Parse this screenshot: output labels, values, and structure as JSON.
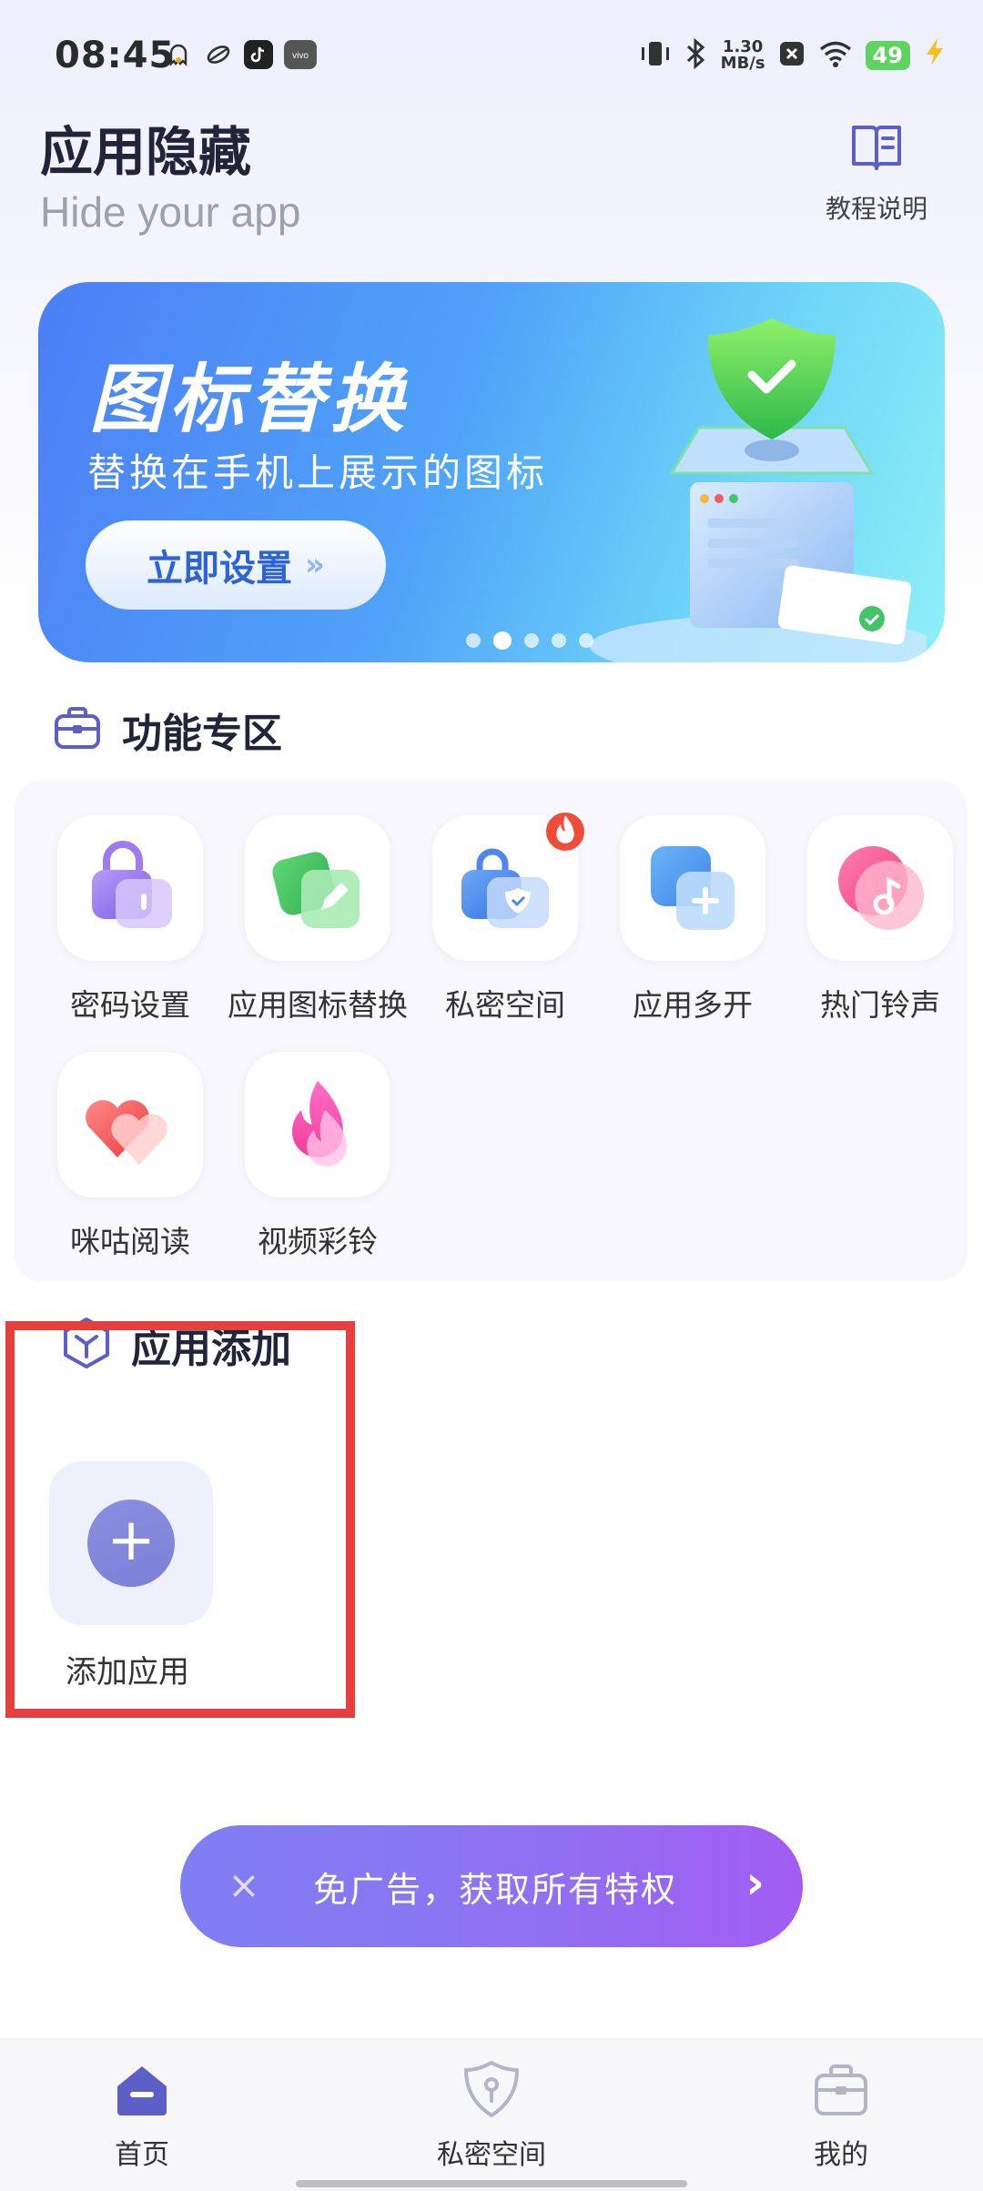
{
  "status_bar": {
    "time": "08:45",
    "speed_value": "1.30",
    "speed_unit": "MB/s",
    "battery": "49",
    "notif_icons": [
      "ghost-icon",
      "leaf-icon",
      "tiktok-icon",
      "vivo-icon"
    ]
  },
  "header": {
    "title": "应用隐藏",
    "subtitle": "Hide your app",
    "tutorial_label": "教程说明"
  },
  "banner": {
    "heading": "图标替换",
    "description": "替换在手机上展示的图标",
    "button_label": "立即设置",
    "button_chevron": "»",
    "dots_total": 5,
    "dots_active": 1
  },
  "features_section": {
    "title": "功能专区",
    "items": [
      {
        "label": "密码设置",
        "icon": "lock-icon"
      },
      {
        "label": "应用图标替换",
        "icon": "edit-icon"
      },
      {
        "label": "私密空间",
        "icon": "shield-bag-icon",
        "badge": "fire"
      },
      {
        "label": "应用多开",
        "icon": "multi-app-icon"
      },
      {
        "label": "热门铃声",
        "icon": "music-note-icon"
      },
      {
        "label": "咪咕阅读",
        "icon": "heart-icon"
      },
      {
        "label": "视频彩铃",
        "icon": "flame-icon"
      }
    ]
  },
  "add_section": {
    "title": "应用添加",
    "add_label": "添加应用",
    "plus": "+"
  },
  "promo": {
    "close": "×",
    "text": "免广告，获取所有特权",
    "arrow": "›"
  },
  "bottom_nav": {
    "items": [
      {
        "label": "首页",
        "icon": "home-icon",
        "active": true
      },
      {
        "label": "私密空间",
        "icon": "shield-key-icon",
        "active": false
      },
      {
        "label": "我的",
        "icon": "profile-bag-icon",
        "active": false
      }
    ]
  },
  "colors": {
    "accent": "#5b5fc7",
    "banner_start": "#4c7ff6",
    "banner_end": "#8ff0f6",
    "highlight_box": "#e5403f",
    "promo_start": "#7f7ff2",
    "promo_end": "#a25cf2"
  }
}
